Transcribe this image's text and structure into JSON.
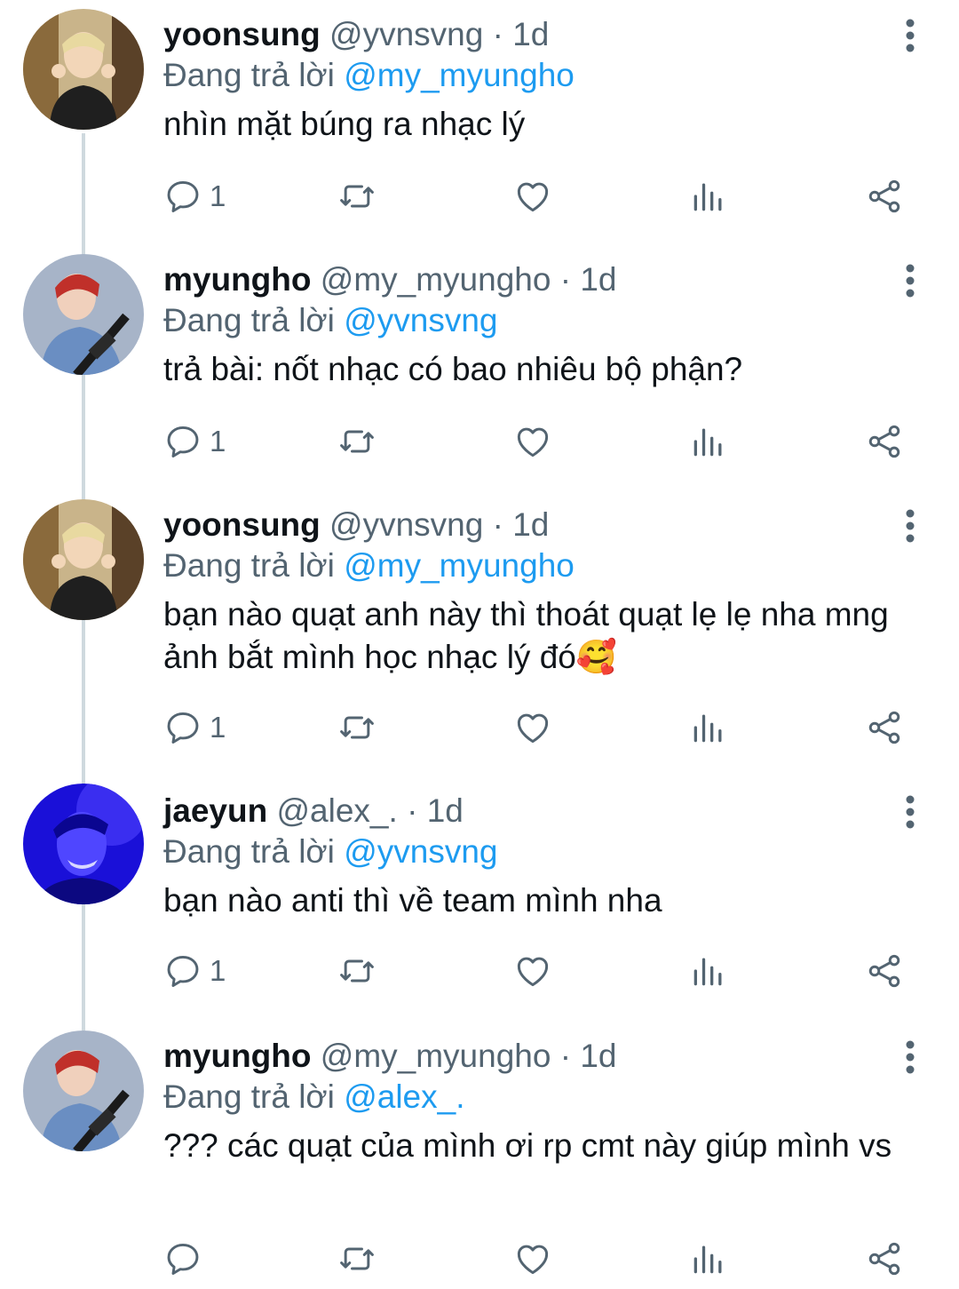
{
  "tweets": [
    {
      "name": "yoonsung",
      "handle": "@yvnsvng",
      "sep": " · ",
      "time": "1d",
      "replying_prefix": "Đang trả lời ",
      "replying_to": "@my_myungho",
      "text": "nhìn mặt búng ra nhạc lý",
      "reply_count": "1",
      "avatar_style": "yellow-tone"
    },
    {
      "name": "myungho",
      "handle": "@my_myungho",
      "sep": " · ",
      "time": "1d",
      "replying_prefix": "Đang trả lời ",
      "replying_to": "@yvnsvng",
      "text": "trả bài: nốt nhạc có bao nhiêu bộ phận?",
      "reply_count": "1",
      "avatar_style": "red-hair-guitar"
    },
    {
      "name": "yoonsung",
      "handle": "@yvnsvng",
      "sep": " · ",
      "time": "1d",
      "replying_prefix": "Đang trả lời ",
      "replying_to": "@my_myungho",
      "text": "bạn nào quạt anh này thì thoát quạt lẹ lẹ nha mng ảnh bắt mình học nhạc lý đó🥰",
      "reply_count": "1",
      "avatar_style": "yellow-tone"
    },
    {
      "name": "jaeyun",
      "handle": "@alex_.",
      "sep": " · ",
      "time": "1d",
      "replying_prefix": "Đang trả lời ",
      "replying_to": "@yvnsvng",
      "text": "bạn nào anti thì về team mình nha",
      "reply_count": "1",
      "avatar_style": "blue-tone"
    },
    {
      "name": "myungho",
      "handle": "@my_myungho",
      "sep": " · ",
      "time": "1d",
      "replying_prefix": "Đang trả lời ",
      "replying_to": "@alex_.",
      "text": "??? các quạt của mình ơi rp cmt này giúp mình vs",
      "reply_count": "",
      "avatar_style": "red-hair-guitar"
    }
  ],
  "icons": {
    "reply": "reply-icon",
    "retweet": "retweet-icon",
    "like": "heart-icon",
    "analytics": "analytics-icon",
    "share": "share-icon",
    "more": "more-vertical-icon"
  },
  "colors": {
    "link": "#1d9bf0",
    "secondary_text": "#536471",
    "thread_line": "#cfd9de"
  }
}
